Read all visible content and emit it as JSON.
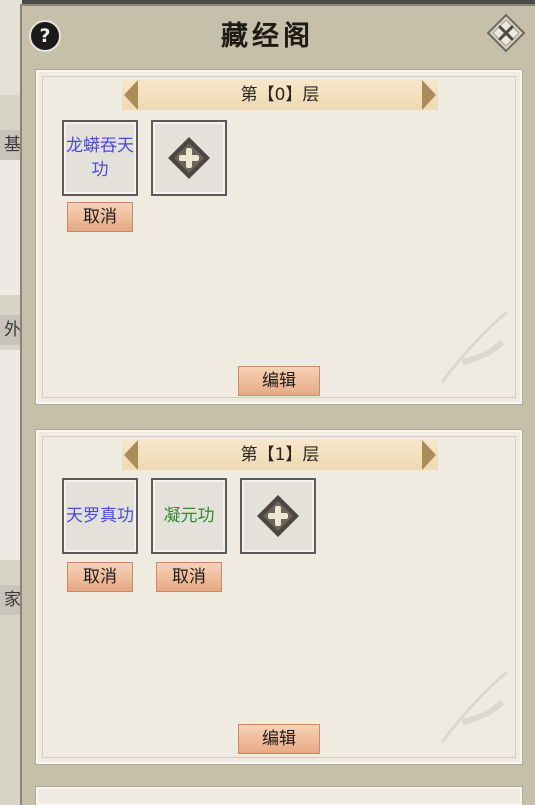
{
  "window": {
    "title": "藏经阁",
    "help_label": "?"
  },
  "background": {
    "side_tabs": [
      "基",
      "外",
      "家"
    ]
  },
  "floors": [
    {
      "title": "第【0】层",
      "skills": [
        {
          "name": "龙蟒吞天功",
          "color": "#4a4ae0",
          "cancel_label": "取消"
        }
      ],
      "edit_label": "编辑"
    },
    {
      "title": "第【1】层",
      "skills": [
        {
          "name": "天罗真功",
          "color": "#4a4ae0",
          "cancel_label": "取消"
        },
        {
          "name": "凝元功",
          "color": "#2e8a2e",
          "cancel_label": "取消"
        }
      ],
      "edit_label": "编辑"
    }
  ],
  "colors": {
    "panel_bg": "#c6bfa9",
    "card_bg": "#efebe1",
    "button_accent": "#e6a984",
    "header_ribbon": "#efd9b4"
  }
}
